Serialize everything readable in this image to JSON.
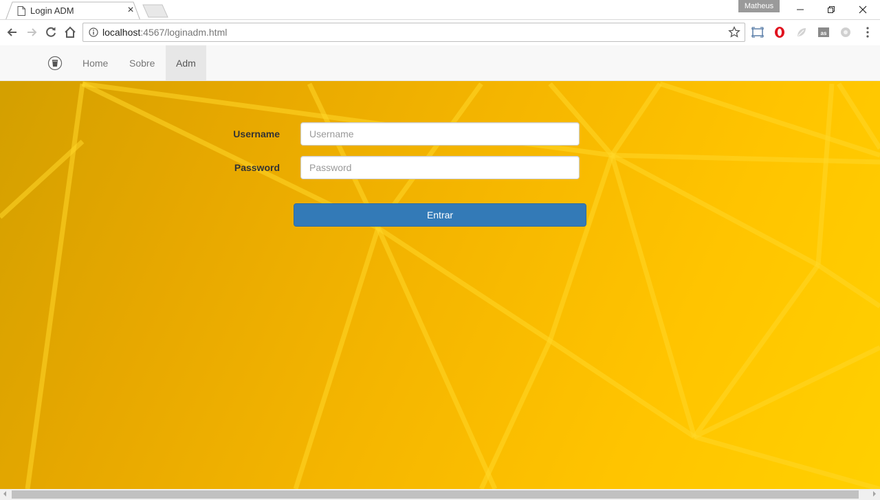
{
  "browser": {
    "tab_title": "Login ADM",
    "tab_close": "×",
    "profile_name": "Matheus",
    "url_host": "localhost",
    "url_rest": ":4567/loginadm.html"
  },
  "navbar": {
    "items": [
      {
        "label": "Home"
      },
      {
        "label": "Sobre"
      },
      {
        "label": "Adm",
        "active": true
      }
    ]
  },
  "form": {
    "username_label": "Username",
    "username_placeholder": "Username",
    "username_value": "",
    "password_label": "Password",
    "password_placeholder": "Password",
    "password_value": "",
    "submit_label": "Entrar"
  },
  "colors": {
    "primary_button": "#337ab7",
    "background_yellow": "#ffc400"
  }
}
